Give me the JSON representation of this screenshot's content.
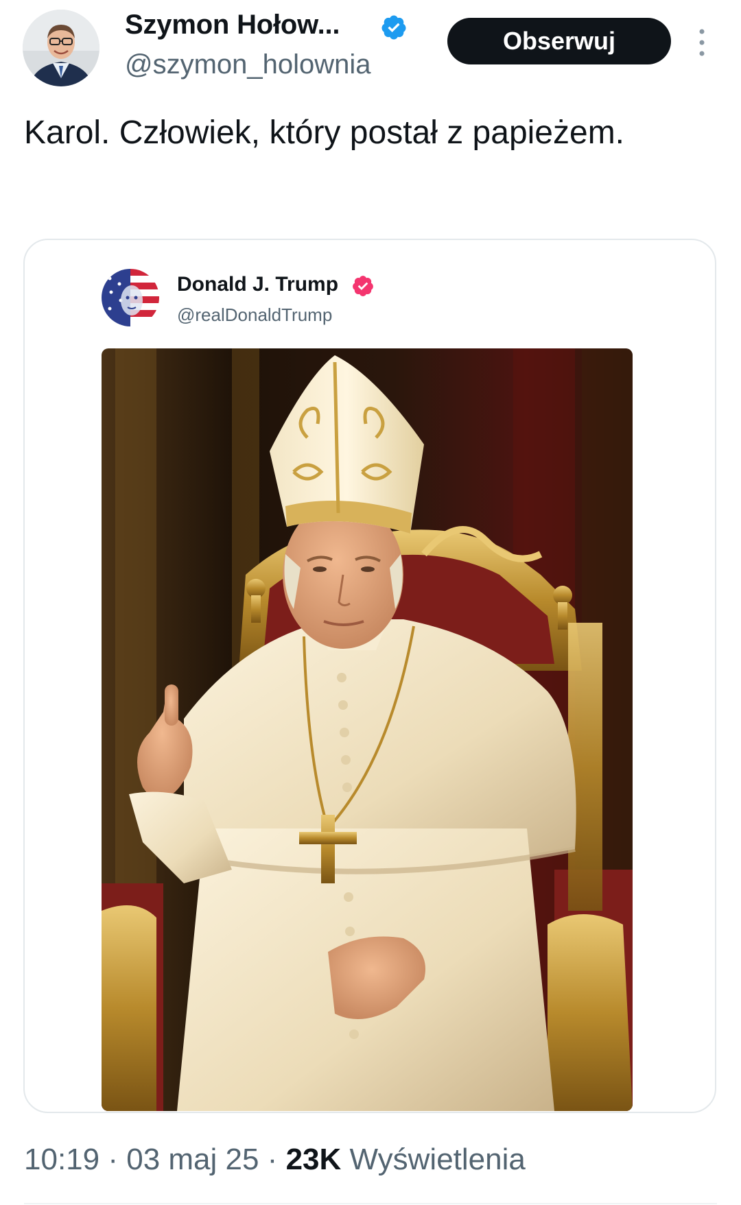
{
  "author": {
    "name": "Szymon Hołow...",
    "handle": "@szymon_holownia",
    "verified": true,
    "verified_color": "#1d9bf0"
  },
  "follow_button": {
    "label": "Obserwuj"
  },
  "more_menu": {
    "icon": "more-vertical-icon"
  },
  "tweet": {
    "text": "Karol. Człowiek, który postał z papieżem."
  },
  "quoted_post": {
    "author_name": "Donald J. Trump",
    "author_handle": "@realDonaldTrump",
    "verified": true,
    "verified_color": "#f4356f",
    "image_description": "photo"
  },
  "meta": {
    "time": "10:19",
    "separator": " · ",
    "date": "03 maj 25",
    "views_count": "23K",
    "views_label": "Wyświetlenia"
  },
  "colors": {
    "text_primary": "#0f1419",
    "text_secondary": "#536471",
    "border": "#e3e8eb",
    "button_bg": "#0f1419"
  }
}
